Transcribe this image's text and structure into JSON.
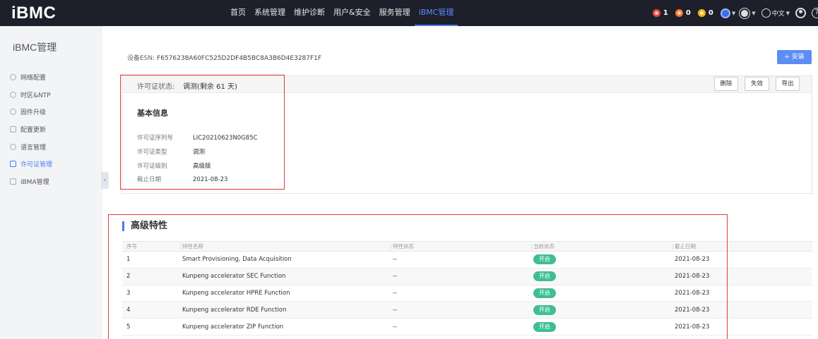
{
  "app": {
    "logo": "iBMC"
  },
  "nav": {
    "items": [
      {
        "label": "首页"
      },
      {
        "label": "系统管理"
      },
      {
        "label": "维护诊断"
      },
      {
        "label": "用户&安全"
      },
      {
        "label": "服务管理"
      },
      {
        "label": "iBMC管理"
      }
    ],
    "active_index": 5
  },
  "status": {
    "alarms": [
      {
        "count": "1",
        "color": "#e84a3c",
        "icon": "critical-alarm-icon"
      },
      {
        "count": "0",
        "color": "#f07a2a",
        "icon": "major-alarm-icon"
      },
      {
        "count": "0",
        "color": "#f2b814",
        "icon": "minor-alarm-icon"
      }
    ],
    "language": "中文",
    "help": "?"
  },
  "sidebar": {
    "title": "iBMC管理",
    "items": [
      {
        "label": "网络配置",
        "icon": "network-icon"
      },
      {
        "label": "时区&NTP",
        "icon": "clock-icon"
      },
      {
        "label": "固件升级",
        "icon": "upgrade-icon"
      },
      {
        "label": "配置更新",
        "icon": "config-icon"
      },
      {
        "label": "语言管理",
        "icon": "language-icon"
      },
      {
        "label": "许可证管理",
        "icon": "license-icon",
        "active": true
      },
      {
        "label": "iBMA管理",
        "icon": "ibma-icon"
      }
    ]
  },
  "device": {
    "esn_label": "设备ESN:",
    "esn_value": "F6576238A60FC525D2DF4B5BC8A3B6D4E3287F1F"
  },
  "install_button": "+ 安装",
  "license": {
    "state_label": "许可证状态:",
    "state_value": "调测(剩余 61 天)",
    "actions": [
      "删除",
      "失效",
      "导出"
    ],
    "basic_title": "基本信息",
    "info": [
      {
        "key": "许可证序列号",
        "value": "LIC20210623N0G85C"
      },
      {
        "key": "许可证类型",
        "value": "调测"
      },
      {
        "key": "许可证级别",
        "value": "高级版"
      },
      {
        "key": "截止日期",
        "value": "2021-08-23"
      }
    ]
  },
  "advanced": {
    "title": "高级特性",
    "columns": [
      "序号",
      "特性名称",
      "特性状态",
      "当前状态",
      "截止日期"
    ],
    "rows": [
      {
        "index": "1",
        "name": "Smart Provisioning, Data Acquisition",
        "feature_state": "--",
        "current": "开启",
        "expiry": "2021-08-23"
      },
      {
        "index": "2",
        "name": "Kunpeng accelerator SEC Function",
        "feature_state": "--",
        "current": "开启",
        "expiry": "2021-08-23"
      },
      {
        "index": "3",
        "name": "Kunpeng accelerator HPRE Function",
        "feature_state": "--",
        "current": "开启",
        "expiry": "2021-08-23"
      },
      {
        "index": "4",
        "name": "Kunpeng accelerator RDE Function",
        "feature_state": "--",
        "current": "开启",
        "expiry": "2021-08-23"
      },
      {
        "index": "5",
        "name": "Kunpeng accelerator ZIP Function",
        "feature_state": "--",
        "current": "开启",
        "expiry": "2021-08-23"
      }
    ]
  },
  "colors": {
    "accent": "#4a7cf0",
    "topbar": "#1d1f2a",
    "badge": "#3fbf8f",
    "highlight_box": "#e03a3a"
  }
}
